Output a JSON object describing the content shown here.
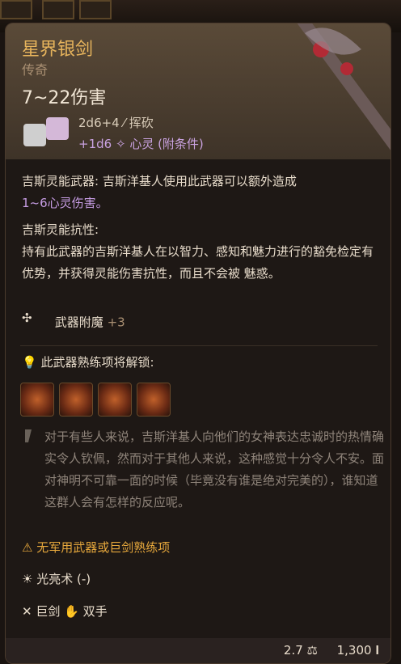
{
  "item": {
    "name": "星界银剑",
    "rarity": "传奇",
    "damage_range": "7~22伤害",
    "damage_dice": "2d6+4",
    "damage_type": "挥砍",
    "bonus_damage": "+1d6",
    "bonus_type": "心灵 (附条件)"
  },
  "abilities": [
    {
      "title": "吉斯灵能武器",
      "text": "吉斯洋基人使用此武器可以额外造成",
      "highlight": "1~6心灵伤害。"
    },
    {
      "title": "吉斯灵能抗性:",
      "text": "持有此武器的吉斯洋基人在以智力、感知和魅力进行的豁免检定有优势，并获得灵能伤害抗性，而且不会被 魅惑。"
    }
  ],
  "enchantment": {
    "label": "武器附魔",
    "value": "+3"
  },
  "unlock": {
    "label": "此武器熟练项将解锁:"
  },
  "lore": "对于有些人来说，吉斯洋基人向他们的女神表达忠诚时的热情确实令人钦佩，然而对于其他人来说，这种感觉十分令人不安。面对神明不可靠一面的时候（毕竟没有谁是绝对完美的），谁知道这群人会有怎样的反应呢。",
  "warning": "无军用武器或巨剑熟练项",
  "spell": "光亮术 (-)",
  "properties": {
    "weapon_type": "巨剑",
    "hands": "双手"
  },
  "footer": {
    "weight": "2.7",
    "price": "1,300"
  },
  "colors": {
    "title": "#e7b45c",
    "warning": "#e7a83c",
    "psychic": "#c79de4"
  }
}
